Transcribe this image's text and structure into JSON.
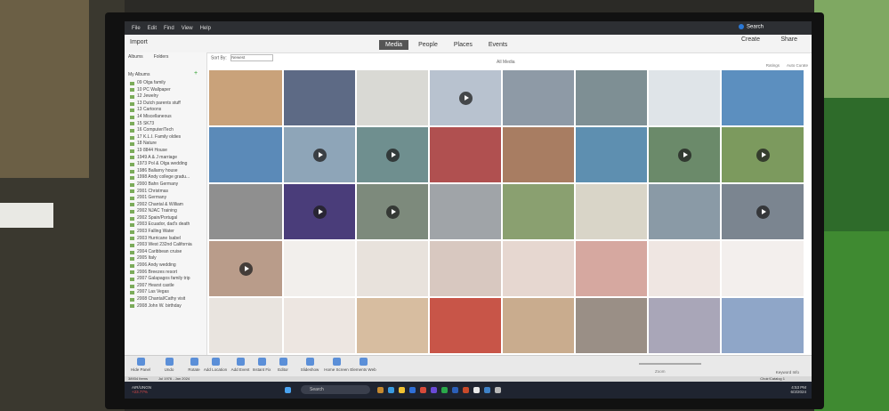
{
  "menubar": {
    "items": [
      "File",
      "Edit",
      "Find",
      "View",
      "Help"
    ]
  },
  "toolbar": {
    "import_label": "Import",
    "search_label": "Search",
    "create_label": "Create",
    "share_label": "Share"
  },
  "tabs": [
    {
      "label": "Media",
      "active": true
    },
    {
      "label": "People",
      "active": false
    },
    {
      "label": "Places",
      "active": false
    },
    {
      "label": "Events",
      "active": false
    }
  ],
  "sidebar": {
    "albums_tab": "Albums",
    "folders_tab": "Folders",
    "section_title": "My Albums",
    "albums": [
      "09 Olga family",
      "10 PC Wallpaper",
      "12 Jewelry",
      "13 Dutch parents stuff",
      "13 Cartoons",
      "14 Miscellaneous",
      "15 SK73",
      "16 Computer/Tech",
      "17 K.L.I. Family oldies",
      "18 Nature",
      "19 8844 House",
      "1949 A & J marriage",
      "1973 Pol & Olga wedding",
      "1986 Ballarny house",
      "1998 Andy college gradu...",
      "2000 Bahn Germany",
      "2001 Christmas",
      "2001 Germany",
      "2002 Chantal & William",
      "2002 NJAC Training",
      "2002 Spain/Portugal",
      "2003 Ecuador, dad's death",
      "2003 Falling Water",
      "2003 Hurricane Isabel",
      "2003 West 232nd California",
      "2004 Caribbean cruise",
      "2005 Italy",
      "2006 Andy wedding",
      "2006 Breezes resort",
      "2007 Galapagos family trip",
      "2007 Hearst castle",
      "2007 Las Vegas",
      "2008 Chantal/Cathy visit",
      "2008 John W. birthday"
    ]
  },
  "sort": {
    "label": "Sort By:",
    "value": "Newest"
  },
  "view": {
    "title": "All Media",
    "ratings_label": "Ratings",
    "autocurate_label": "Auto Curate"
  },
  "bottom_tools": [
    "Hide Panel",
    "Undo",
    "Rotate",
    "Add Location",
    "Add Event",
    "Instant Fix",
    "Editor",
    "Slideshow",
    "Home Screen",
    "Elements Web"
  ],
  "zoom_label": "Zoom",
  "keyword_label": "Keyword Info",
  "status": {
    "count": "38934 Items",
    "range": "Jul 1976 - Jan 2024"
  },
  "catalog_label": "Choir/Catalog 1",
  "taskbar": {
    "search": "Search",
    "weather_title": "AIR/UNGN",
    "weather_change": "+23.77%",
    "time": "4:53 PM",
    "date": "6/3/2024"
  }
}
